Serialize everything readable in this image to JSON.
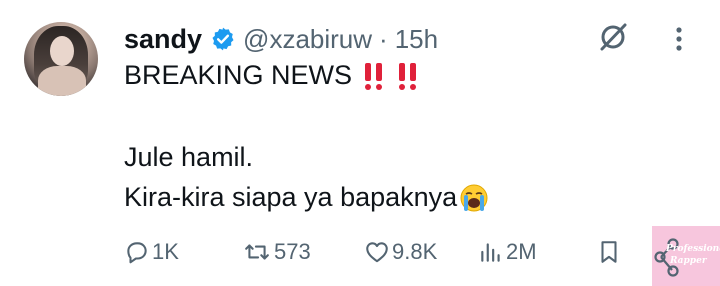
{
  "post": {
    "display_name": "sandy",
    "handle": "@xzabiruw",
    "separator": "·",
    "time": "15h",
    "verified_icon": "verified-badge-icon",
    "line1": "BREAKING NEWS",
    "line2": "Jule hamil.",
    "line3": "Kira-kira siapa ya bapaknya",
    "emoji_line1": "double-exclamation-icon",
    "emoji_line3": "loudly-crying-face-icon"
  },
  "actions": {
    "replies": "1K",
    "reposts": "573",
    "likes": "9.8K",
    "views": "2M"
  },
  "watermark": {
    "line1": "Professional",
    "line2": "Rapper"
  },
  "colors": {
    "text": "#0f1419",
    "secondary": "#536471",
    "verified": "#1d9bf0",
    "emoji_red": "#e0213a",
    "watermark_bg": "#f7c6dd"
  }
}
